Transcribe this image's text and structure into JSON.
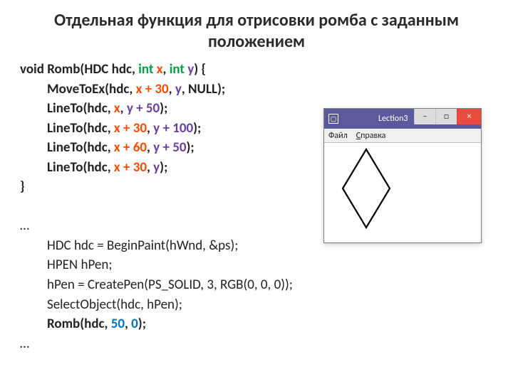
{
  "title": "Отдельная функция для отрисовки ромба с заданным положением",
  "func": {
    "sig_void": "void ",
    "sig_name": "Romb(HDC hdc, ",
    "sig_int1": "int",
    "sig_sp1": " ",
    "sig_x": "x",
    "sig_comma": ", ",
    "sig_int2": "int",
    "sig_sp2": " ",
    "sig_y": "y",
    "sig_close": ") {",
    "l1_a": "MoveToEx(hdc, ",
    "l1_x": "x + 30",
    "l1_b": ", ",
    "l1_y": "y",
    "l1_c": ", NULL);",
    "l2_a": "LineTo(hdc, ",
    "l2_x": "x",
    "l2_b": ", ",
    "l2_y": "y + 50",
    "l2_c": ");",
    "l3_a": "LineTo(hdc, ",
    "l3_x": "x + 30",
    "l3_b": ", ",
    "l3_y": "y + 100",
    "l3_c": ");",
    "l4_a": "LineTo(hdc, ",
    "l4_x": "x + 60",
    "l4_b": ", ",
    "l4_y": "y + 50",
    "l4_c": ");",
    "l5_a": "LineTo(hdc, ",
    "l5_x": "x + 30",
    "l5_b": ", ",
    "l5_y": "y",
    "l5_c": ");",
    "close": "}"
  },
  "snippet": {
    "ell1": "…",
    "s1": "HDC hdc = BeginPaint(hWnd, &ps);",
    "s2": "HPEN hPen;",
    "s3": "hPen = CreatePen(PS_SOLID, 3, RGB(0, 0, 0));",
    "s4": "SelectObject(hdc, hPen);",
    "s5a": "Romb(hdc, ",
    "s5n1": "50",
    "s5b": ", ",
    "s5n2": "0",
    "s5c": ");",
    "ell2": "…"
  },
  "win": {
    "title": "Lection3",
    "menu_file": "Файл",
    "menu_help_u": "С",
    "menu_help_rest": "правка",
    "min": "–",
    "max": "□",
    "close": "×",
    "iconMark": "▢"
  }
}
